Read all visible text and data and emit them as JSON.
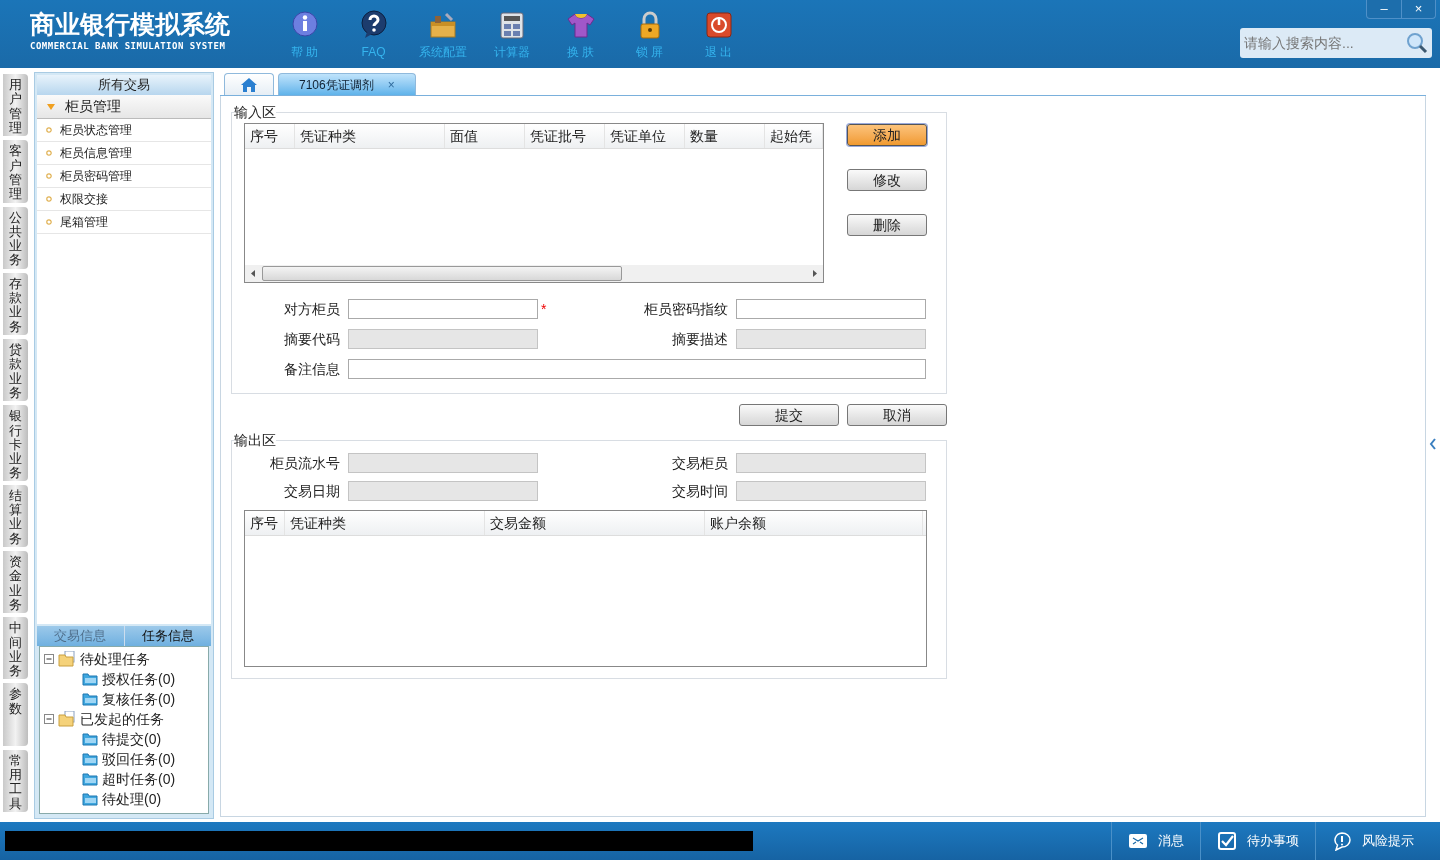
{
  "header": {
    "title": "商业银行模拟系统",
    "subtitle": "COMMERCIAL BANK SIMULATION SYSTEM",
    "toolbar": [
      {
        "kind": "info",
        "label": "帮 助"
      },
      {
        "kind": "faq",
        "label": "FAQ"
      },
      {
        "kind": "config",
        "label": "系统配置"
      },
      {
        "kind": "calculator",
        "label": "计算器"
      },
      {
        "kind": "skin",
        "label": "换 肤"
      },
      {
        "kind": "lock",
        "label": "锁 屏"
      },
      {
        "kind": "exit",
        "label": "退 出"
      }
    ],
    "window_controls": [
      "–",
      "×"
    ],
    "search": {
      "placeholder": "请输入搜索内容..."
    }
  },
  "side_tabs": [
    {
      "label": "用户管理"
    },
    {
      "label": "客户管理"
    },
    {
      "label": "公共业务"
    },
    {
      "label": "存款业务"
    },
    {
      "label": "贷款业务"
    },
    {
      "label": "银行卡业务"
    },
    {
      "label": "结算业务"
    },
    {
      "label": "资金业务"
    },
    {
      "label": "中间业务"
    },
    {
      "label": "参数"
    },
    {
      "label": "常用工具"
    }
  ],
  "sidebar": {
    "header": "所有交易",
    "group": {
      "label": "柜员管理",
      "expanded": true
    },
    "items": [
      {
        "label": "柜员状态管理"
      },
      {
        "label": "柜员信息管理"
      },
      {
        "label": "柜员密码管理"
      },
      {
        "label": "权限交接"
      },
      {
        "label": "尾箱管理"
      }
    ]
  },
  "task_panel": {
    "tabs": [
      {
        "label": "交易信息",
        "selected": false
      },
      {
        "label": "任务信息",
        "selected": true
      }
    ],
    "tree": [
      {
        "label": "待处理任务",
        "expanded": true,
        "children": [
          {
            "label": "授权任务(0)"
          },
          {
            "label": "复核任务(0)"
          }
        ]
      },
      {
        "label": "已发起的任务",
        "expanded": true,
        "children": [
          {
            "label": "待提交(0)"
          },
          {
            "label": "驳回任务(0)"
          },
          {
            "label": "超时任务(0)"
          },
          {
            "label": "待处理(0)"
          }
        ]
      }
    ]
  },
  "tabs": [
    {
      "kind": "home",
      "selected": false
    },
    {
      "kind": "page",
      "label": "7106凭证调剂",
      "close": "×",
      "selected": true
    }
  ],
  "input_area": {
    "legend": "输入区",
    "table": {
      "columns": [
        "序号",
        "凭证种类",
        "面值",
        "凭证批号",
        "凭证单位",
        "数量",
        "起始凭"
      ]
    },
    "buttons": [
      {
        "label": "添加",
        "focused": true
      },
      {
        "label": "修改",
        "focused": false
      },
      {
        "label": "删除",
        "focused": false
      }
    ],
    "fields": [
      {
        "label": "对方柜员",
        "disabled": false,
        "marker": "*",
        "kind": "half"
      },
      {
        "label": "柜员密码指纹",
        "disabled": false,
        "kind": "half"
      },
      {
        "label": "摘要代码",
        "disabled": true,
        "kind": "half"
      },
      {
        "label": "摘要描述",
        "disabled": true,
        "kind": "half"
      },
      {
        "label": "备注信息",
        "disabled": false,
        "kind": "wide"
      }
    ]
  },
  "actions": [
    {
      "label": "提交"
    },
    {
      "label": "取消"
    }
  ],
  "output_area": {
    "legend": "输出区",
    "fields": [
      {
        "label": "柜员流水号",
        "disabled": true
      },
      {
        "label": "交易柜员",
        "disabled": true
      },
      {
        "label": "交易日期",
        "disabled": true
      },
      {
        "label": "交易时间",
        "disabled": true
      }
    ],
    "table": {
      "columns": [
        "序号",
        "凭证种类",
        "交易金额",
        "账户余额"
      ]
    }
  },
  "status_bar": {
    "items": [
      {
        "kind": "message",
        "label": "消息"
      },
      {
        "kind": "todo",
        "label": "待办事项"
      },
      {
        "kind": "risk",
        "label": "风险提示"
      }
    ]
  }
}
